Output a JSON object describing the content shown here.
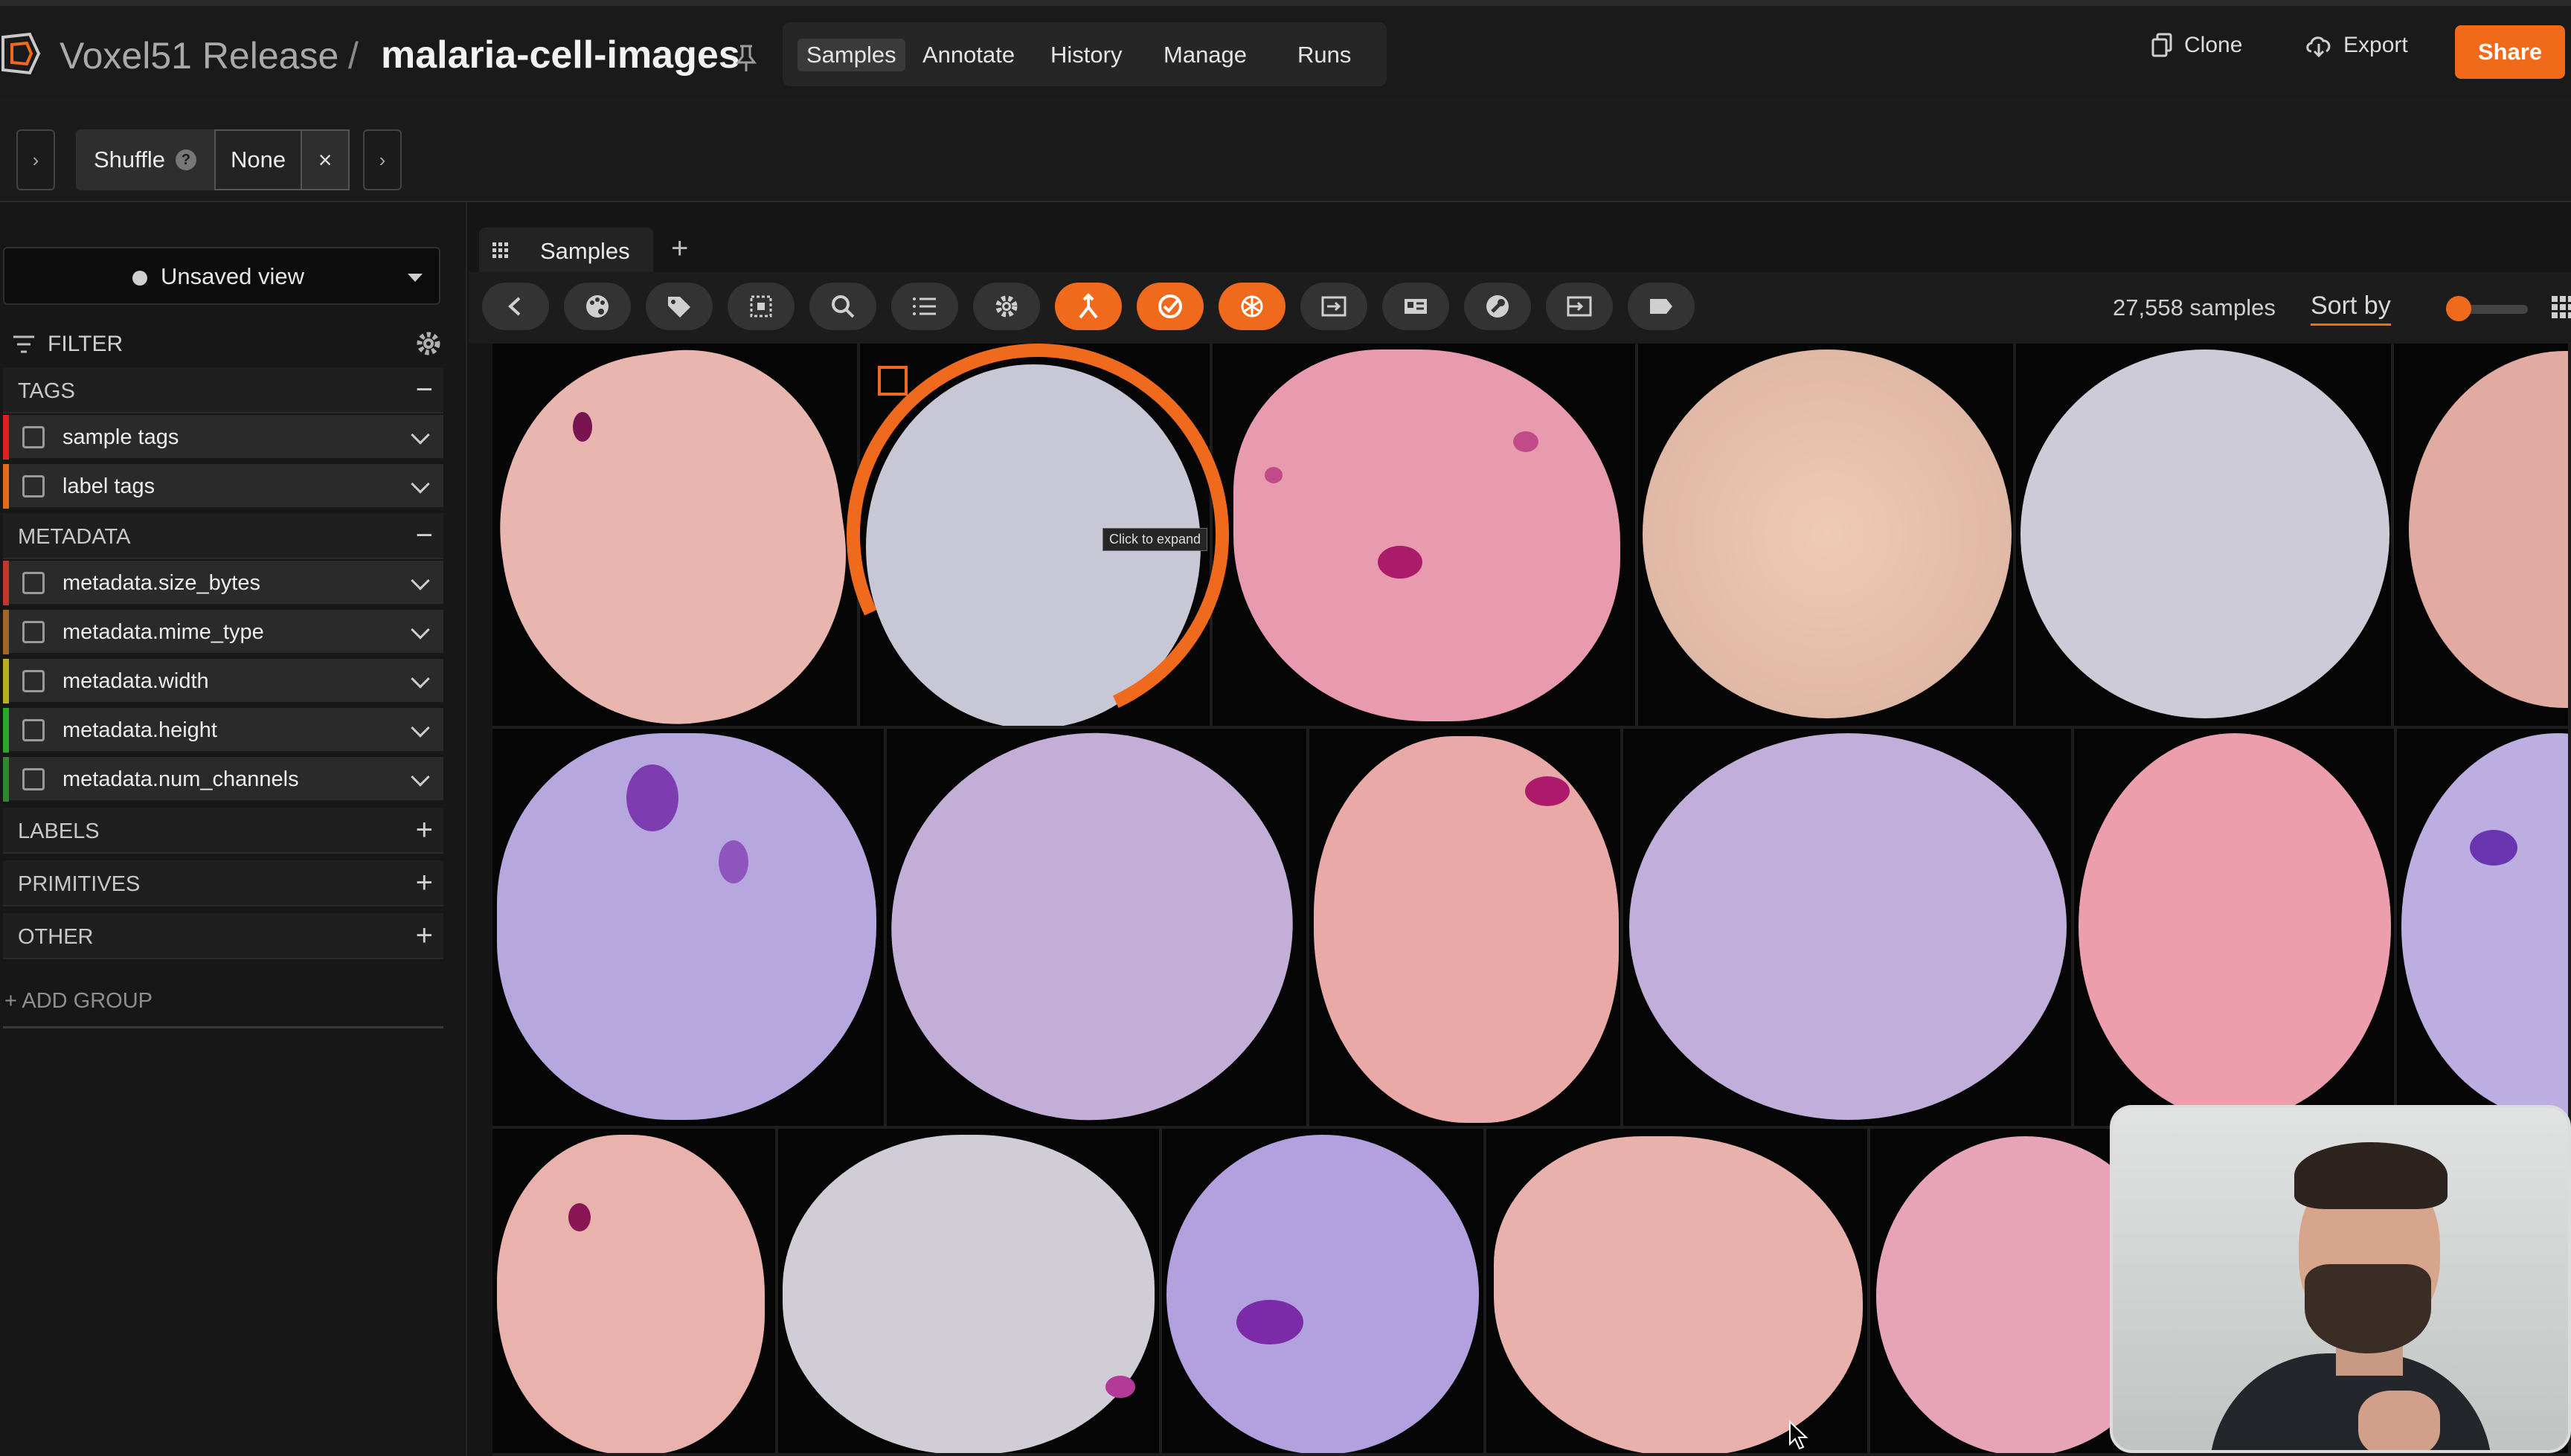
{
  "header": {
    "org": "Voxel51 Release",
    "separator": "/",
    "dataset": "malaria-cell-images",
    "nav": [
      {
        "label": "Samples",
        "active": true
      },
      {
        "label": "Annotate",
        "active": false
      },
      {
        "label": "History",
        "active": false
      },
      {
        "label": "Manage",
        "active": false
      },
      {
        "label": "Runs",
        "active": false
      }
    ],
    "clone_label": "Clone",
    "export_label": "Export",
    "share_label": "Share",
    "accent": "#f16a1a"
  },
  "viewbar": {
    "stage_name": "Shuffle",
    "help": "?",
    "stage_param": "None",
    "remove": "×",
    "left_chevron": "›",
    "right_chevron": "›"
  },
  "sidebar": {
    "view_name": "Unsaved view",
    "filter_label": "FILTER",
    "sections": [
      {
        "label": "TAGS",
        "control": "−"
      },
      {
        "label": "METADATA",
        "control": "−"
      },
      {
        "label": "LABELS",
        "control": "+"
      },
      {
        "label": "PRIMITIVES",
        "control": "+"
      },
      {
        "label": "OTHER",
        "control": "+"
      }
    ],
    "tag_fields": [
      {
        "label": "sample tags",
        "color": "#e02020"
      },
      {
        "label": "label tags",
        "color": "#e46a1e"
      }
    ],
    "metadata_fields": [
      {
        "label": "metadata.size_bytes",
        "color": "#c0392b"
      },
      {
        "label": "metadata.mime_type",
        "color": "#a0662c"
      },
      {
        "label": "metadata.width",
        "color": "#b8b020"
      },
      {
        "label": "metadata.height",
        "color": "#2aa82a"
      },
      {
        "label": "metadata.num_channels",
        "color": "#2f8a2f"
      }
    ],
    "add_group": "+ ADD GROUP"
  },
  "main": {
    "tab_label": "Samples",
    "tab_add": "+",
    "sample_count": "27,558 samples",
    "sort_label": "Sort by",
    "tooltip": "Click to expand",
    "zoom_fraction": 0.15,
    "actions": [
      {
        "icon": "chevron-left-icon",
        "active": false
      },
      {
        "icon": "palette-icon",
        "active": false
      },
      {
        "icon": "tag-icon",
        "active": false
      },
      {
        "icon": "select-region-icon",
        "active": false
      },
      {
        "icon": "search-icon",
        "active": false
      },
      {
        "icon": "list-icon",
        "active": false
      },
      {
        "icon": "settings-icon",
        "active": false
      },
      {
        "icon": "merge-icon",
        "active": true
      },
      {
        "icon": "check-circle-icon",
        "active": true
      },
      {
        "icon": "openai-icon",
        "active": true
      },
      {
        "icon": "panel-enter-icon",
        "active": false
      },
      {
        "icon": "card-icon",
        "active": false
      },
      {
        "icon": "wrench-icon",
        "active": false
      },
      {
        "icon": "export-panel-icon",
        "active": false
      },
      {
        "icon": "label-icon",
        "active": false
      }
    ]
  }
}
